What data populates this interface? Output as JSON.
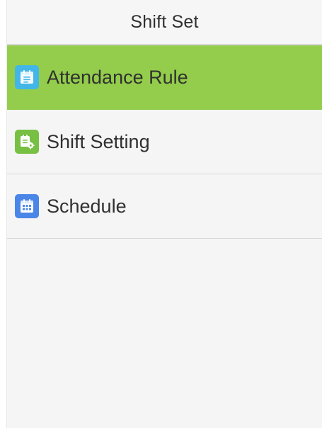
{
  "screen": {
    "title": "Shift Set"
  },
  "menu": {
    "items": [
      {
        "label": "Attendance Rule",
        "icon": "attendance-rule-icon",
        "icon_color": "#42b6e8",
        "selected": true
      },
      {
        "label": "Shift Setting",
        "icon": "shift-setting-icon",
        "icon_color": "#78c043",
        "selected": false
      },
      {
        "label": "Schedule",
        "icon": "schedule-icon",
        "icon_color": "#4a86e8",
        "selected": false
      }
    ]
  },
  "colors": {
    "selected_row": "#93cd4b",
    "background": "#f5f5f5",
    "divider": "#d9d9d9"
  }
}
